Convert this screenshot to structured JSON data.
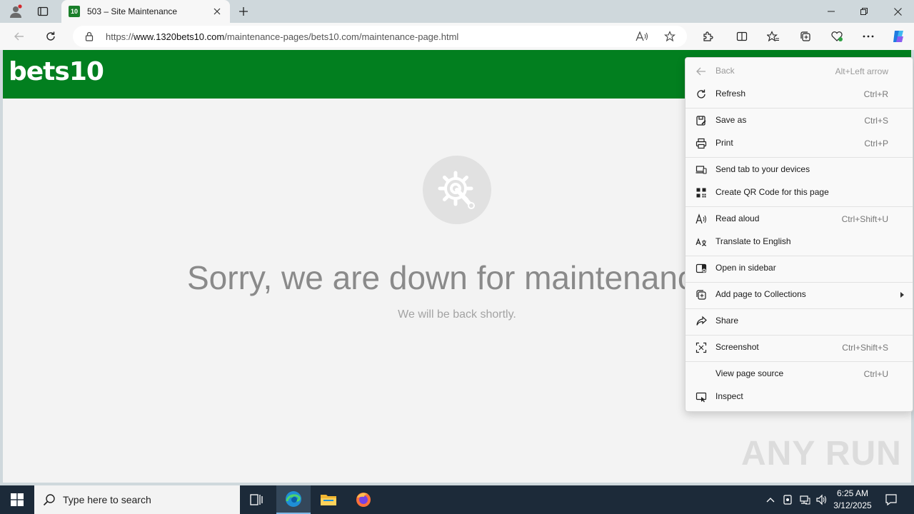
{
  "browser": {
    "tab": {
      "favicon_text": "10",
      "title": "503 – Site Maintenance"
    },
    "address": {
      "scheme": "https://",
      "host": "www.1320bets10.com",
      "path": "/maintenance-pages/bets10.com/maintenance-page.html"
    }
  },
  "page": {
    "logo": "bets10",
    "headline": "Sorry, we are down for maintenance.",
    "subline": "We will be back shortly.",
    "header_color": "#027f1f"
  },
  "context_menu": {
    "items": [
      {
        "label": "Back",
        "shortcut": "Alt+Left arrow",
        "disabled": true
      },
      {
        "label": "Refresh",
        "shortcut": "Ctrl+R"
      },
      {
        "label": "Save as",
        "shortcut": "Ctrl+S"
      },
      {
        "label": "Print",
        "shortcut": "Ctrl+P"
      },
      {
        "label": "Send tab to your devices",
        "shortcut": ""
      },
      {
        "label": "Create QR Code for this page",
        "shortcut": ""
      },
      {
        "label": "Read aloud",
        "shortcut": "Ctrl+Shift+U"
      },
      {
        "label": "Translate to English",
        "shortcut": ""
      },
      {
        "label": "Open in sidebar",
        "shortcut": ""
      },
      {
        "label": "Add page to Collections",
        "shortcut": ""
      },
      {
        "label": "Share",
        "shortcut": ""
      },
      {
        "label": "Screenshot",
        "shortcut": "Ctrl+Shift+S"
      },
      {
        "label": "View page source",
        "shortcut": "Ctrl+U"
      },
      {
        "label": "Inspect",
        "shortcut": ""
      }
    ]
  },
  "watermark": "ANY RUN",
  "taskbar": {
    "search_placeholder": "Type here to search",
    "time": "6:25 AM",
    "date": "3/12/2025"
  }
}
